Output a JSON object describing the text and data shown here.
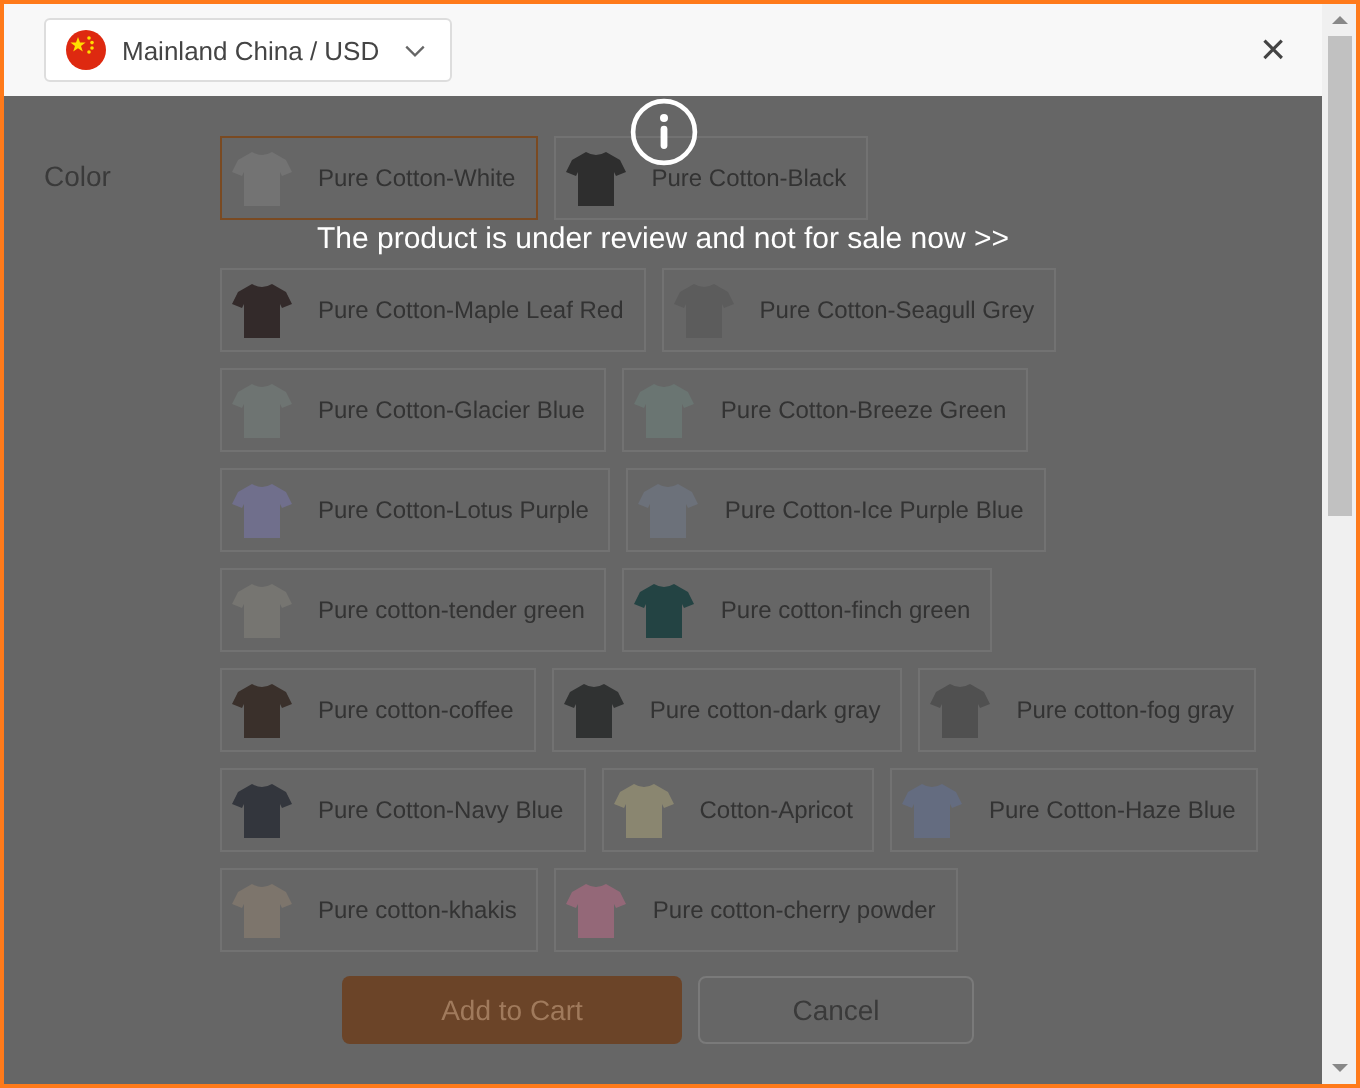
{
  "region_selector": {
    "label": "Mainland China / USD"
  },
  "close": "×",
  "color_label": "Color",
  "color_rows": [
    [
      {
        "label": "Pure Cotton-White",
        "color": "#737373",
        "selected": true
      },
      {
        "label": "Pure Cotton-Black",
        "color": "#2e2e2e",
        "selected": false
      }
    ],
    [
      {
        "label": "Pure Cotton-Maple Leaf Red",
        "color": "#332a2a",
        "selected": false
      },
      {
        "label": "Pure Cotton-Seagull Grey",
        "color": "#5c5c5c",
        "selected": false
      }
    ],
    [
      {
        "label": "Pure Cotton-Glacier Blue",
        "color": "#6e7472",
        "selected": false
      },
      {
        "label": "Pure Cotton-Breeze Green",
        "color": "#6a7572",
        "selected": false
      }
    ],
    [
      {
        "label": "Pure Cotton-Lotus Purple",
        "color": "#706f8c",
        "selected": false
      },
      {
        "label": "Pure Cotton-Ice Purple Blue",
        "color": "#6c717a",
        "selected": false
      }
    ],
    [
      {
        "label": "Pure cotton-tender green",
        "color": "#767571",
        "selected": false
      },
      {
        "label": "Pure cotton-finch green",
        "color": "#234343",
        "selected": false
      }
    ],
    [
      {
        "label": "Pure cotton-coffee",
        "color": "#3a302b",
        "selected": false
      },
      {
        "label": "Pure cotton-dark gray",
        "color": "#303232",
        "selected": false
      },
      {
        "label": "Pure cotton-fog gray",
        "color": "#505050",
        "selected": false
      }
    ],
    [
      {
        "label": "Pure Cotton-Navy Blue",
        "color": "#33363d",
        "selected": false
      },
      {
        "label": "Cotton-Apricot",
        "color": "#8a8670",
        "selected": false
      },
      {
        "label": "Pure Cotton-Haze Blue",
        "color": "#646c80",
        "selected": false
      }
    ],
    [
      {
        "label": "Pure cotton-khakis",
        "color": "#7d756c",
        "selected": false
      },
      {
        "label": "Pure cotton-cherry powder",
        "color": "#946878",
        "selected": false
      }
    ]
  ],
  "buttons": {
    "primary": "Add to Cart",
    "secondary": "Cancel"
  },
  "notice": {
    "message": "The product is under review and not for sale now >>"
  }
}
